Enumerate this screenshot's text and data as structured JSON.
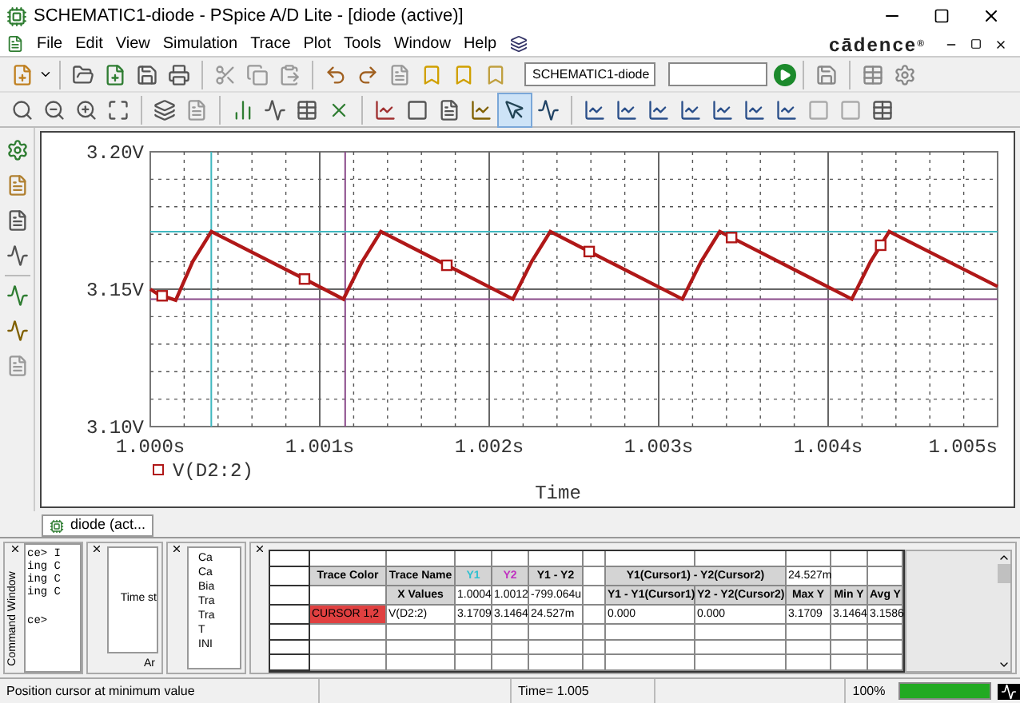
{
  "window": {
    "title": "SCHEMATIC1-diode - PSpice A/D Lite - [diode (active)]"
  },
  "menu": [
    "File",
    "Edit",
    "View",
    "Simulation",
    "Trace",
    "Plot",
    "Tools",
    "Window",
    "Help"
  ],
  "logo": {
    "text": "cādence",
    "mark": "®"
  },
  "toolbar": {
    "profile_field": "SCHEMATIC1-diode"
  },
  "plot": {
    "chart_data": {
      "type": "line",
      "xlabel": "Time",
      "xlim": [
        1.0,
        1.005
      ],
      "ylim": [
        3.1,
        3.2
      ],
      "xticks": [
        {
          "value": 1.0,
          "label": "1.000s"
        },
        {
          "value": 1.001,
          "label": "1.001s"
        },
        {
          "value": 1.002,
          "label": "1.002s"
        },
        {
          "value": 1.003,
          "label": "1.003s"
        },
        {
          "value": 1.004,
          "label": "1.004s"
        },
        {
          "value": 1.005,
          "label": "1.005s"
        }
      ],
      "yticks": [
        {
          "value": 3.1,
          "label": "3.10V"
        },
        {
          "value": 3.15,
          "label": "3.15V"
        },
        {
          "value": 3.2,
          "label": "3.20V"
        }
      ],
      "x": [
        1.0,
        1.00005,
        1.00007,
        1.00015,
        1.00025,
        1.00036,
        1.00091,
        1.00114,
        1.00125,
        1.00136,
        1.00175,
        1.00214,
        1.00225,
        1.00236,
        1.00259,
        1.00314,
        1.00325,
        1.00336,
        1.00343,
        1.00414,
        1.00425,
        1.00431,
        1.00436,
        1.005
      ],
      "series": [
        {
          "name": "V(D2:2)",
          "color": "#b01818",
          "values": [
            3.15,
            3.148,
            3.1476,
            3.146,
            3.16,
            3.171,
            3.1537,
            3.1464,
            3.16,
            3.171,
            3.1587,
            3.1464,
            3.16,
            3.171,
            3.1637,
            3.1464,
            3.16,
            3.171,
            3.1688,
            3.1464,
            3.16,
            3.166,
            3.171,
            3.151
          ]
        }
      ],
      "grid": true,
      "ref_lines": [
        {
          "axis": "x",
          "value": 1.00036,
          "color": "#40b8c0"
        },
        {
          "axis": "x",
          "value": 1.00115,
          "color": "#8a4a8a"
        },
        {
          "axis": "y",
          "value": 3.1709,
          "color": "#40b8c0"
        },
        {
          "axis": "y",
          "value": 3.1464,
          "color": "#8a4a8a"
        }
      ]
    }
  },
  "tab": {
    "label": "diode (act..."
  },
  "command_window": {
    "title": "Command Window",
    "lines": [
      "ce> I",
      "ing C",
      "ing C",
      "ing C",
      "ce>"
    ]
  },
  "panel_2": {
    "text": "Time st",
    "tab": "Ar"
  },
  "panel_3": {
    "items": [
      "Ca",
      "Ca",
      "Bia",
      "Tra",
      "Tra",
      "T",
      "INI"
    ]
  },
  "cursor_table": {
    "rows": [
      {
        "cells": [
          null,
          null,
          null,
          null,
          null,
          null,
          null,
          null,
          null,
          null,
          null
        ]
      },
      {
        "cells": [
          {
            "text": "Trace Color",
            "kind": "header"
          },
          {
            "text": "Trace Name",
            "kind": "header"
          },
          {
            "text": "Y1",
            "kind": "header",
            "color": "#30c0d0"
          },
          {
            "text": "Y2",
            "kind": "header",
            "color": "#c030c0"
          },
          {
            "text": "Y1 - Y2",
            "kind": "header"
          },
          null,
          {
            "text": "Y1(Cursor1) - Y2(Cursor2)",
            "kind": "header",
            "colspan": 2
          },
          {
            "text": "24.527m",
            "kind": "value"
          },
          null,
          null
        ]
      },
      {
        "cells": [
          null,
          {
            "text": "X Values",
            "kind": "header"
          },
          {
            "text": "1.0004",
            "kind": "value"
          },
          {
            "text": "1.0012",
            "kind": "value"
          },
          {
            "text": "-799.064u",
            "kind": "value"
          },
          null,
          {
            "text": "Y1 - Y1(Cursor1)",
            "kind": "header"
          },
          {
            "text": "Y2 - Y2(Cursor2)",
            "kind": "header"
          },
          {
            "text": "Max Y",
            "kind": "header"
          },
          {
            "text": "Min Y",
            "kind": "header"
          },
          {
            "text": "Avg Y",
            "kind": "header"
          }
        ]
      },
      {
        "cells": [
          {
            "text": "CURSOR 1,2",
            "kind": "trace",
            "color": "#e04040"
          },
          {
            "text": "V(D2:2)",
            "kind": "value"
          },
          {
            "text": "3.1709",
            "kind": "value"
          },
          {
            "text": "3.1464",
            "kind": "value"
          },
          {
            "text": "24.527m",
            "kind": "value"
          },
          null,
          {
            "text": "0.000",
            "kind": "value"
          },
          {
            "text": "0.000",
            "kind": "value"
          },
          {
            "text": "3.1709",
            "kind": "value"
          },
          {
            "text": "3.1464",
            "kind": "value"
          },
          {
            "text": "3.1586",
            "kind": "value"
          }
        ]
      },
      {
        "cells": [
          null,
          null,
          null,
          null,
          null,
          null,
          null,
          null,
          null,
          null,
          null
        ]
      },
      {
        "cells": [
          null,
          null,
          null,
          null,
          null,
          null,
          null,
          null,
          null,
          null,
          null
        ]
      },
      {
        "cells": [
          null,
          null,
          null,
          null,
          null,
          null,
          null,
          null,
          null,
          null,
          null
        ]
      }
    ]
  },
  "status_bar": {
    "message": "Position cursor at minimum value",
    "time": "Time= 1.005",
    "zoom": "100%",
    "progress": {
      "level": 1
    }
  }
}
